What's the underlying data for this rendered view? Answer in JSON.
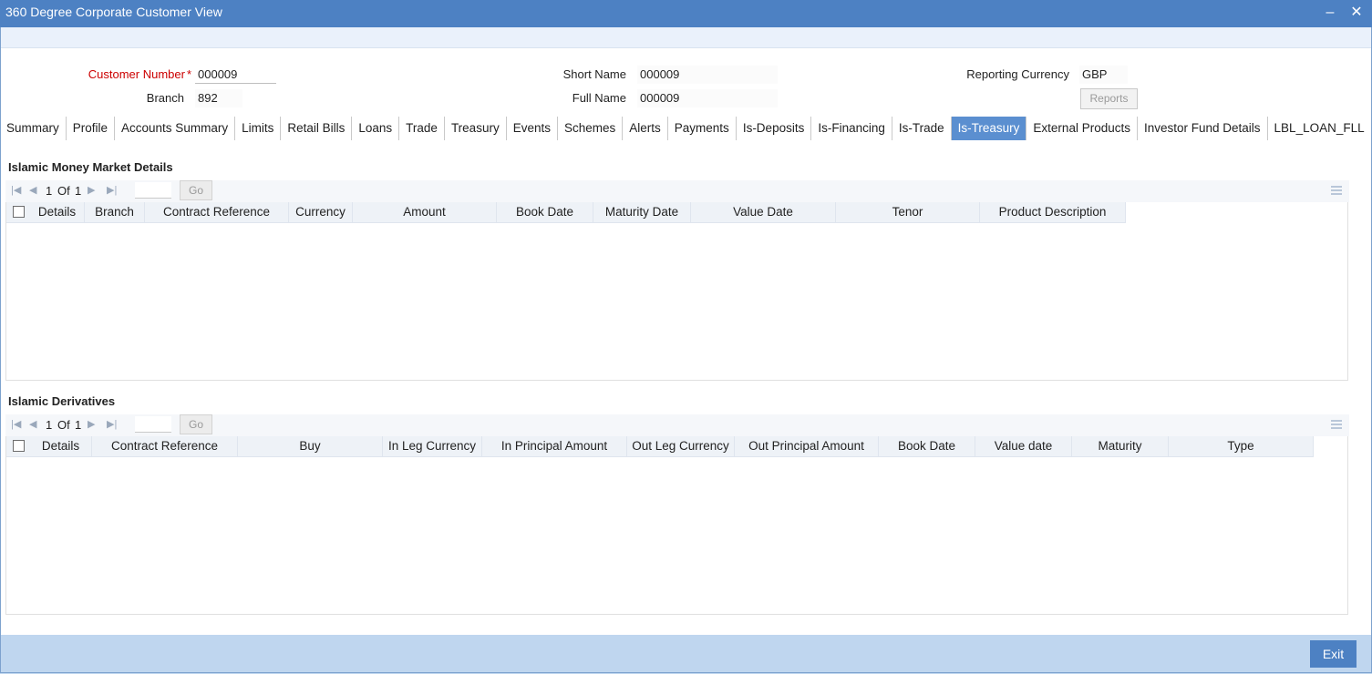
{
  "window": {
    "title": "360 Degree Corporate Customer View",
    "minimize": "–",
    "close": "✕"
  },
  "header": {
    "customer_number_label": "Customer Number",
    "required_mark": "*",
    "customer_number": "000009",
    "branch_label": "Branch",
    "branch": "892",
    "short_name_label": "Short Name",
    "short_name": "000009",
    "full_name_label": "Full Name",
    "full_name": "000009",
    "reporting_currency_label": "Reporting Currency",
    "reporting_currency": "GBP",
    "reports_button": "Reports"
  },
  "tabs": [
    {
      "label": "Summary"
    },
    {
      "label": "Profile"
    },
    {
      "label": "Accounts Summary"
    },
    {
      "label": "Limits"
    },
    {
      "label": "Retail Bills"
    },
    {
      "label": "Loans"
    },
    {
      "label": "Trade"
    },
    {
      "label": "Treasury"
    },
    {
      "label": "Events"
    },
    {
      "label": "Schemes"
    },
    {
      "label": "Alerts"
    },
    {
      "label": "Payments"
    },
    {
      "label": "Is-Deposits"
    },
    {
      "label": "Is-Financing"
    },
    {
      "label": "Is-Trade"
    },
    {
      "label": "Is-Treasury"
    },
    {
      "label": "External Products"
    },
    {
      "label": "Investor Fund Details"
    },
    {
      "label": "LBL_LOAN_FLL"
    }
  ],
  "active_tab": "Is-Treasury",
  "money_market": {
    "title": "Islamic Money Market Details",
    "pager": {
      "current": "1",
      "of": "Of",
      "total": "1",
      "go": "Go"
    },
    "columns": [
      "Details",
      "Branch",
      "Contract Reference",
      "Currency",
      "Amount",
      "Book Date",
      "Maturity Date",
      "Value Date",
      "Tenor",
      "Product Description"
    ]
  },
  "derivatives": {
    "title": "Islamic Derivatives",
    "pager": {
      "current": "1",
      "of": "Of",
      "total": "1",
      "go": "Go"
    },
    "columns": [
      "Details",
      "Contract Reference",
      "Buy",
      "In Leg Currency",
      "In Principal Amount",
      "Out Leg Currency",
      "Out Principal Amount",
      "Book Date",
      "Value date",
      "Maturity",
      "Type"
    ]
  },
  "footer": {
    "exit_button": "Exit"
  }
}
